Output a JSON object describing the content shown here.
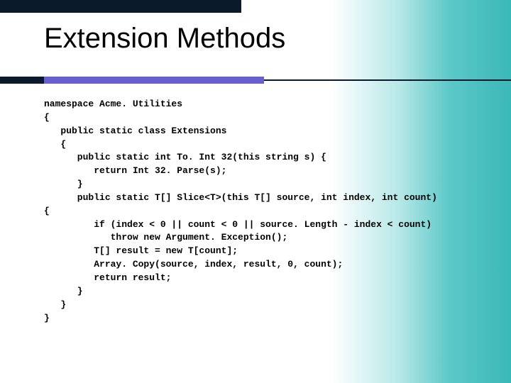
{
  "slide": {
    "title": "Extension Methods",
    "code": "namespace Acme. Utilities\n{\n   public static class Extensions\n   {\n      public static int To. Int 32(this string s) {\n         return Int 32. Parse(s);\n      }\n      public static T[] Slice<T>(this T[] source, int index, int count)\n{\n         if (index < 0 || count < 0 || source. Length - index < count)\n            throw new Argument. Exception();\n         T[] result = new T[count];\n         Array. Copy(source, index, result, 0, count);\n         return result;\n      }\n   }\n}"
  }
}
